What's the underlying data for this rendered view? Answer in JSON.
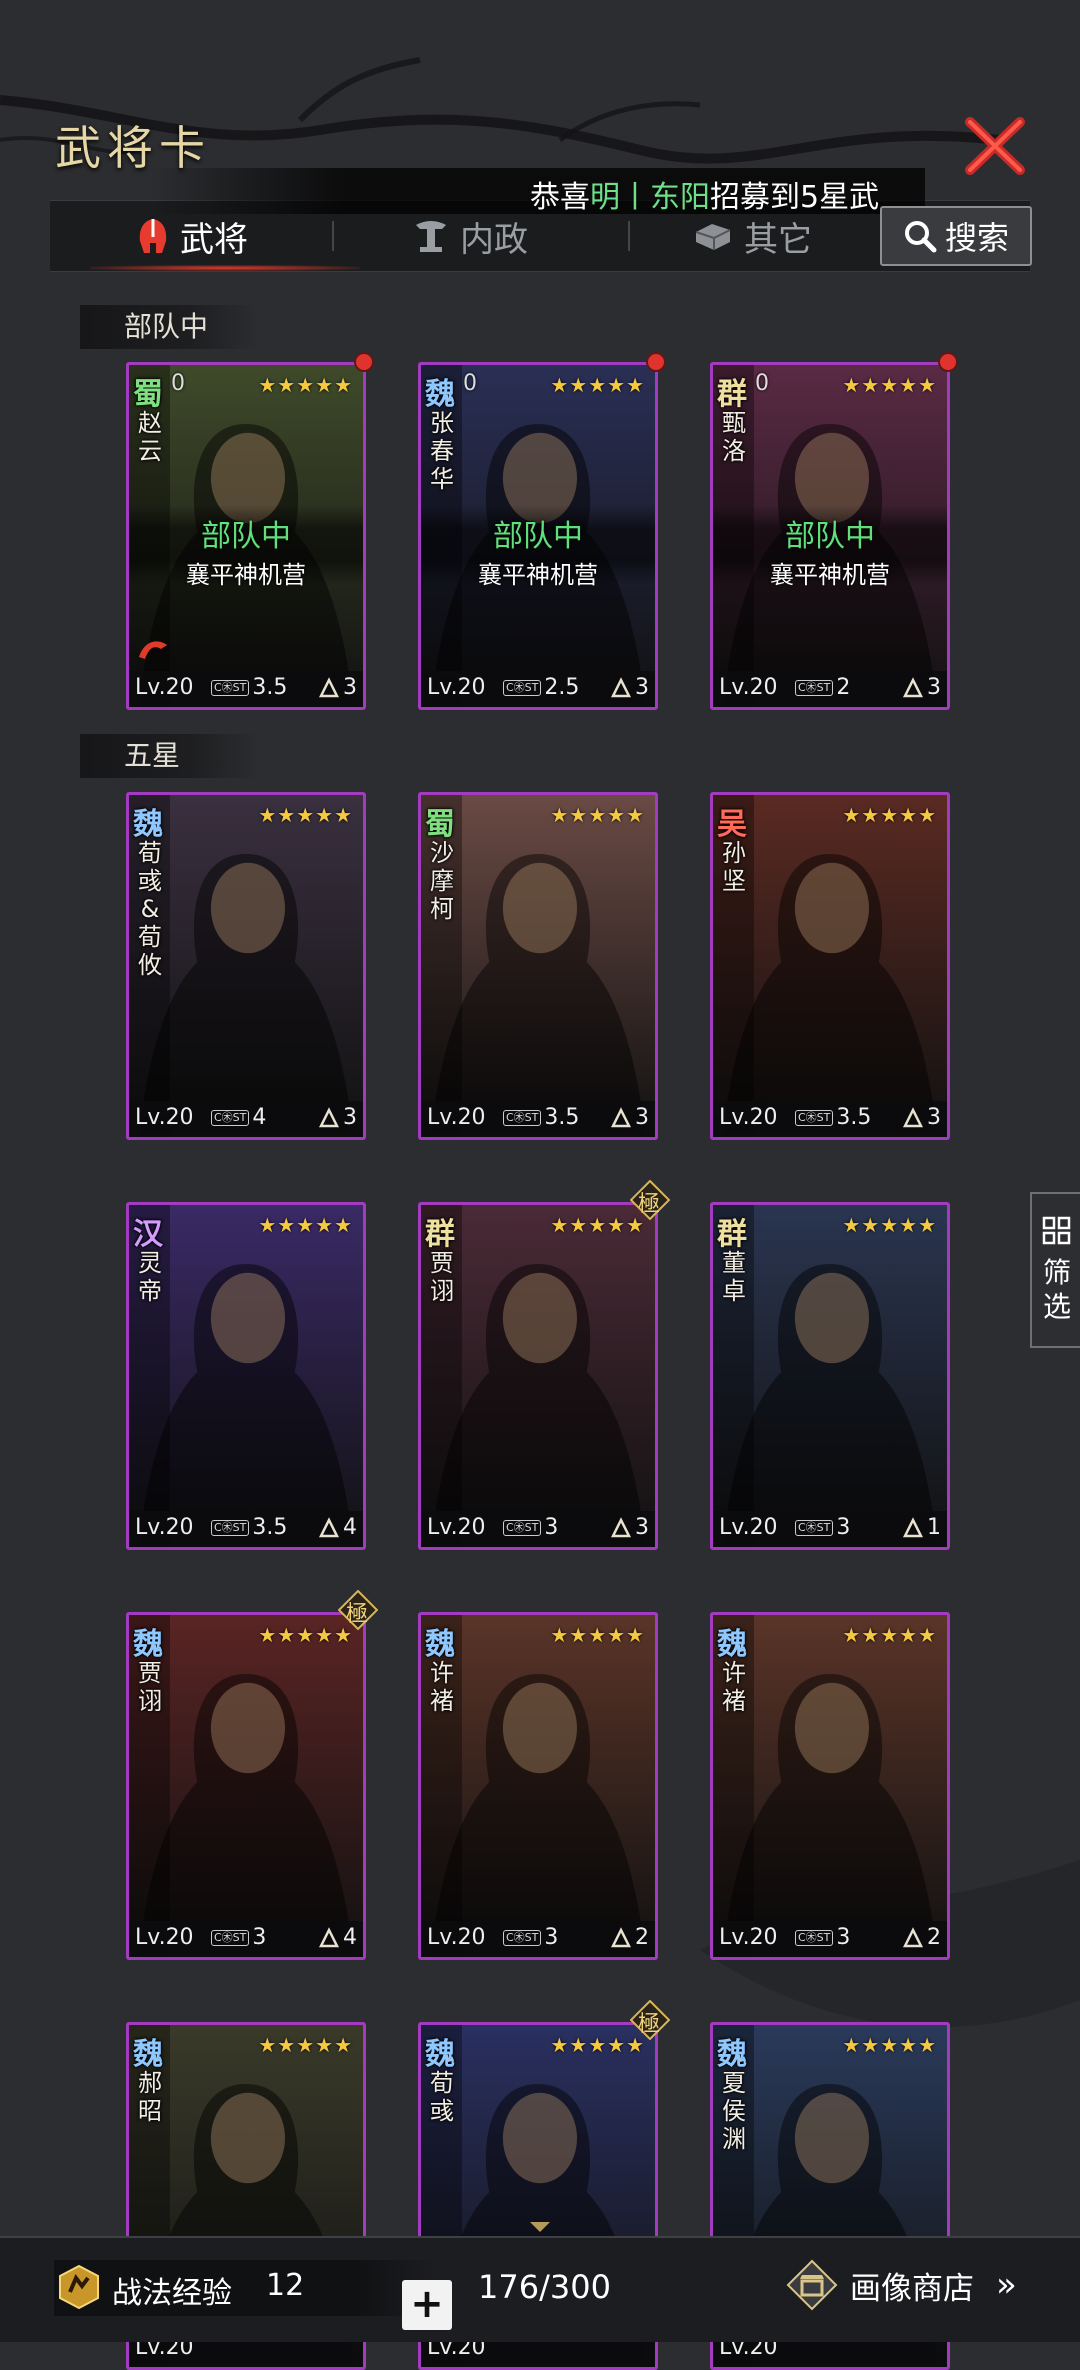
{
  "header": {
    "title": "武将卡",
    "marquee": {
      "prefix": "恭喜",
      "name1": "明",
      "sep": "丨",
      "name2": "东阳",
      "suffix": "招募到5星武"
    }
  },
  "tabs": [
    {
      "label": "武将",
      "icon": "helmet-icon",
      "active": true
    },
    {
      "label": "内政",
      "icon": "pillar-icon",
      "active": false
    },
    {
      "label": "其它",
      "icon": "ingot-icon",
      "active": false
    }
  ],
  "search": {
    "label": "搜索"
  },
  "filter": {
    "label": "筛选"
  },
  "sections": {
    "deployed": "部队中",
    "five_star": "五星"
  },
  "status": {
    "in_army": "部队中",
    "camp": "襄平神机营"
  },
  "card_labels": {
    "lv_prefix": "Lv.",
    "stars": "★★★★★",
    "extreme": "極",
    "cost_badge": "C㊍ST"
  },
  "cards": [
    {
      "faction": "蜀",
      "faction_color": "#7ee07e",
      "count": "0",
      "name": "赵云",
      "level": "20",
      "cost": "3.5",
      "unit_icon": "cavalry-shield-icon",
      "unit_num": "3",
      "in_army": true,
      "red_dot": true,
      "sp": true,
      "theme": "#3f4a2a"
    },
    {
      "faction": "魏",
      "faction_color": "#8fc7ff",
      "count": "0",
      "name": "张春华",
      "level": "20",
      "cost": "2.5",
      "unit_icon": "bow-icon",
      "unit_num": "3",
      "in_army": true,
      "red_dot": true,
      "theme": "#2a2f55"
    },
    {
      "faction": "群",
      "faction_color": "#f0e0a0",
      "count": "0",
      "name": "甄洛",
      "level": "20",
      "cost": "2",
      "unit_icon": "bow-icon",
      "unit_num": "3",
      "in_army": true,
      "red_dot": true,
      "theme": "#5a2a44"
    },
    {
      "faction": "魏",
      "faction_color": "#8fc7ff",
      "name": "荀彧&荀攸",
      "level": "20",
      "cost": "4",
      "unit_icon": "cavalry-shield-icon",
      "unit_num": "3",
      "theme": "#3a3040"
    },
    {
      "faction": "蜀",
      "faction_color": "#7ee07e",
      "name": "沙摩柯",
      "level": "20",
      "cost": "3.5",
      "unit_icon": "bow-icon",
      "unit_num": "3",
      "theme": "#6a4a44"
    },
    {
      "faction": "吴",
      "faction_color": "#ff6a5a",
      "name": "孙坚",
      "level": "20",
      "cost": "3.5",
      "unit_icon": "cavalry-shield-icon",
      "unit_num": "3",
      "theme": "#5a2a22"
    },
    {
      "faction": "汉",
      "faction_color": "#d49cff",
      "name": "灵帝",
      "level": "20",
      "cost": "3.5",
      "unit_icon": "bow-icon",
      "unit_num": "4",
      "theme": "#3a2a66"
    },
    {
      "faction": "群",
      "faction_color": "#f0e0a0",
      "name": "贾诩",
      "level": "20",
      "cost": "3",
      "unit_icon": "cavalry-shield-icon",
      "unit_num": "3",
      "extreme": true,
      "theme": "#4a2a36"
    },
    {
      "faction": "群",
      "faction_color": "#f0e0a0",
      "name": "董卓",
      "level": "20",
      "cost": "3",
      "unit_icon": "horse-icon",
      "unit_num": "1",
      "theme": "#2a3550"
    },
    {
      "faction": "魏",
      "faction_color": "#8fc7ff",
      "name": "贾诩",
      "level": "20",
      "cost": "3",
      "unit_icon": "bow-icon",
      "unit_num": "4",
      "extreme": true,
      "theme": "#5a2424"
    },
    {
      "faction": "魏",
      "faction_color": "#8fc7ff",
      "name": "许褚",
      "level": "20",
      "cost": "3",
      "unit_icon": "cavalry-shield-icon",
      "unit_num": "2",
      "theme": "#5a3428"
    },
    {
      "faction": "魏",
      "faction_color": "#8fc7ff",
      "name": "许褚",
      "level": "20",
      "cost": "3",
      "unit_icon": "cavalry-shield-icon",
      "unit_num": "2",
      "theme": "#5a3428"
    },
    {
      "faction": "魏",
      "faction_color": "#8fc7ff",
      "name": "郝昭",
      "level": "20",
      "cost": "",
      "unit_icon": "",
      "unit_num": "",
      "theme": "#3a3a2a"
    },
    {
      "faction": "魏",
      "faction_color": "#8fc7ff",
      "name": "荀彧",
      "level": "20",
      "cost": "",
      "unit_icon": "",
      "unit_num": "",
      "extreme": true,
      "theme": "#2a3060"
    },
    {
      "faction": "魏",
      "faction_color": "#8fc7ff",
      "name": "夏侯渊",
      "level": "20",
      "cost": "",
      "unit_icon": "",
      "unit_num": "",
      "theme": "#2a3a5a"
    }
  ],
  "bottom": {
    "exp_label": "战法经验",
    "exp_value": "12",
    "plus": "+",
    "count": "176/300",
    "shop_label": "画像商店",
    "shop_arrow": "»"
  }
}
